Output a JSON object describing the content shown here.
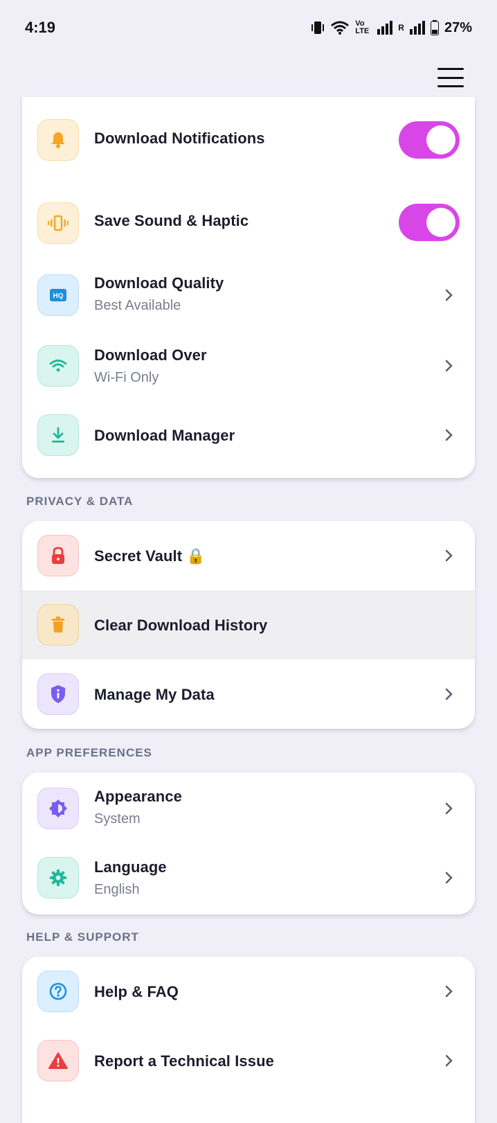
{
  "status_bar": {
    "time": "4:19",
    "battery_percent": "27%",
    "volte_label": "Vo LTE",
    "roaming_label": "R"
  },
  "colors": {
    "accent_toggle": "#d946e8",
    "background": "#f0eff8"
  },
  "downloads_card": {
    "items": [
      {
        "title": "Download Notifications",
        "icon": "bell-icon",
        "control": "toggle",
        "toggle_on": true
      },
      {
        "title": "Save Sound & Haptic",
        "icon": "vibrate-icon",
        "control": "toggle",
        "toggle_on": true
      },
      {
        "title": "Download Quality",
        "subtitle": "Best Available",
        "icon": "hq-icon",
        "control": "chevron"
      },
      {
        "title": "Download Over",
        "subtitle": "Wi-Fi Only",
        "icon": "wifi-icon",
        "control": "chevron"
      },
      {
        "title": "Download Manager",
        "icon": "download-icon",
        "control": "chevron"
      }
    ]
  },
  "privacy": {
    "label": "PRIVACY & DATA",
    "items": [
      {
        "title": "Secret Vault 🔒",
        "icon": "lock-icon",
        "control": "chevron"
      },
      {
        "title": "Clear Download History",
        "icon": "trash-icon",
        "control": "none"
      },
      {
        "title": "Manage My Data",
        "icon": "shield-icon",
        "control": "chevron"
      }
    ]
  },
  "app_preferences": {
    "label": "APP PREFERENCES",
    "items": [
      {
        "title": "Appearance",
        "subtitle": "System",
        "icon": "brightness-icon",
        "control": "chevron"
      },
      {
        "title": "Language",
        "subtitle": "English",
        "icon": "gear-icon",
        "control": "chevron"
      }
    ]
  },
  "help_support": {
    "label": "HELP & SUPPORT",
    "items": [
      {
        "title": "Help & FAQ",
        "icon": "help-icon",
        "control": "chevron"
      },
      {
        "title": "Report a Technical Issue",
        "icon": "warning-icon",
        "control": "chevron"
      }
    ]
  }
}
